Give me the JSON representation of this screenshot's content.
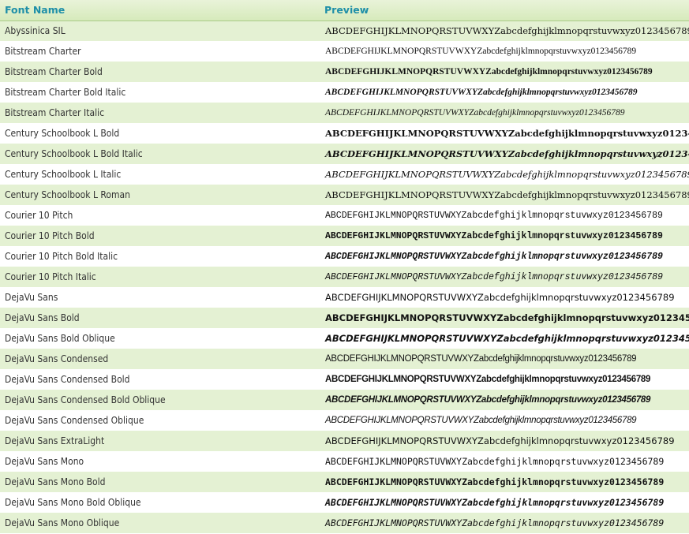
{
  "header": {
    "font_name_label": "Font Name",
    "preview_label": "Preview"
  },
  "preview_sample": "ABCDEFGHIJKLMNOPQRSTUVWXYZabcdefghijklmnopqrstuvwxyz0123456789",
  "fonts": [
    {
      "name": "Abyssinica SIL"
    },
    {
      "name": "Bitstream Charter"
    },
    {
      "name": "Bitstream Charter Bold"
    },
    {
      "name": "Bitstream Charter Bold Italic"
    },
    {
      "name": "Bitstream Charter Italic"
    },
    {
      "name": "Century Schoolbook L Bold"
    },
    {
      "name": "Century Schoolbook L Bold Italic"
    },
    {
      "name": "Century Schoolbook L Italic"
    },
    {
      "name": "Century Schoolbook L Roman"
    },
    {
      "name": "Courier 10 Pitch"
    },
    {
      "name": "Courier 10 Pitch Bold"
    },
    {
      "name": "Courier 10 Pitch Bold Italic"
    },
    {
      "name": "Courier 10 Pitch Italic"
    },
    {
      "name": "DejaVu Sans"
    },
    {
      "name": "DejaVu Sans Bold"
    },
    {
      "name": "DejaVu Sans Bold Oblique"
    },
    {
      "name": "DejaVu Sans Condensed"
    },
    {
      "name": "DejaVu Sans Condensed Bold"
    },
    {
      "name": "DejaVu Sans Condensed Bold Oblique"
    },
    {
      "name": "DejaVu Sans Condensed Oblique"
    },
    {
      "name": "DejaVu Sans ExtraLight"
    },
    {
      "name": "DejaVu Sans Mono"
    },
    {
      "name": "DejaVu Sans Mono Bold"
    },
    {
      "name": "DejaVu Sans Mono Bold Oblique"
    },
    {
      "name": "DejaVu Sans Mono Oblique"
    }
  ]
}
